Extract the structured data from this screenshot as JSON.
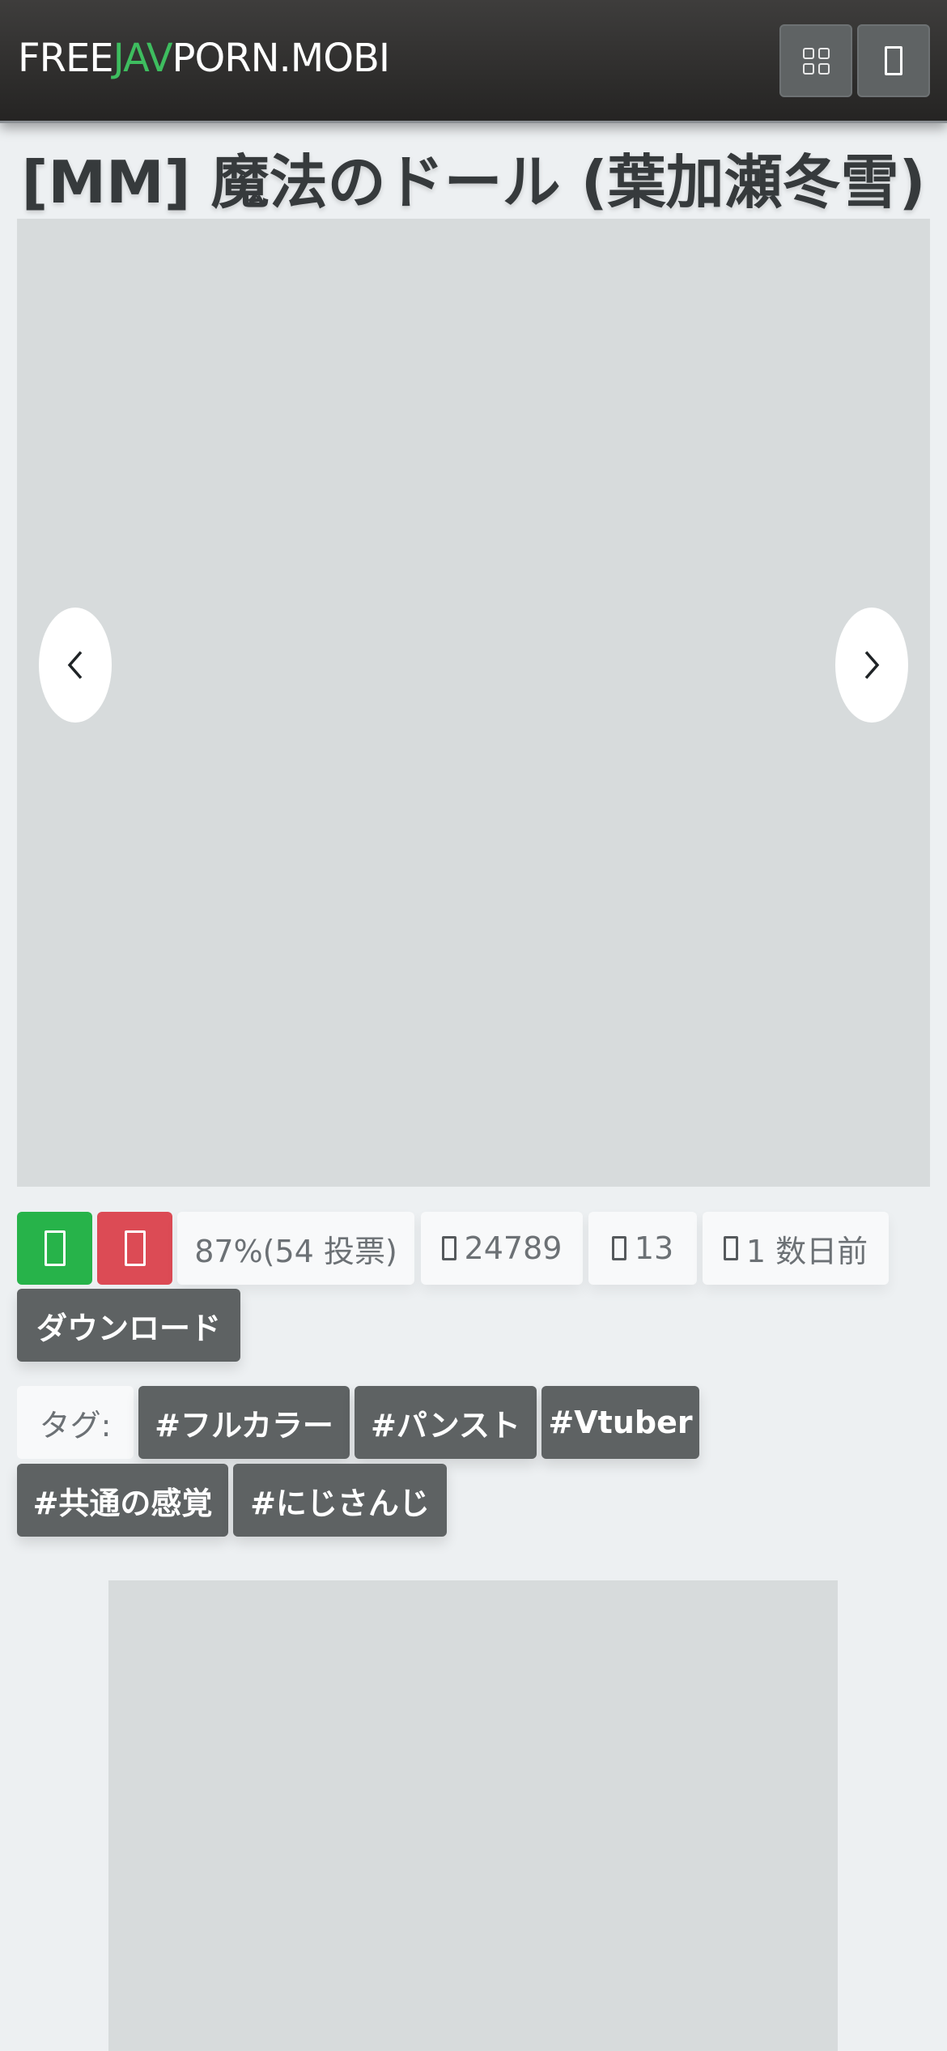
{
  "header": {
    "logo_part1": "FREE",
    "logo_accent": "JAV",
    "logo_part2": "PORN.MOBI",
    "accent_color": "#3ebd5f",
    "buttons": [
      {
        "icon": "grid-icon"
      },
      {
        "icon": "square-icon"
      }
    ]
  },
  "page": {
    "title": "[MM] 魔法のドール (葉加瀬冬雪)"
  },
  "slider": {
    "prev_icon": "chevron-left-icon",
    "next_icon": "chevron-right-icon"
  },
  "stats": {
    "like_icon": "thumbs-up-icon",
    "dislike_icon": "thumbs-down-icon",
    "rating": "87%(54 投票)",
    "views": "24789",
    "pages": "13",
    "date": "1 数日前",
    "like_color": "#27b34a",
    "dislike_color": "#dc4b55"
  },
  "download": {
    "label": "ダウンロード"
  },
  "tags": {
    "label": "タグ:",
    "items": [
      "#フルカラー",
      "#パンスト",
      "#Vtuber",
      "#共通の感覚",
      "#にじさんじ"
    ]
  }
}
